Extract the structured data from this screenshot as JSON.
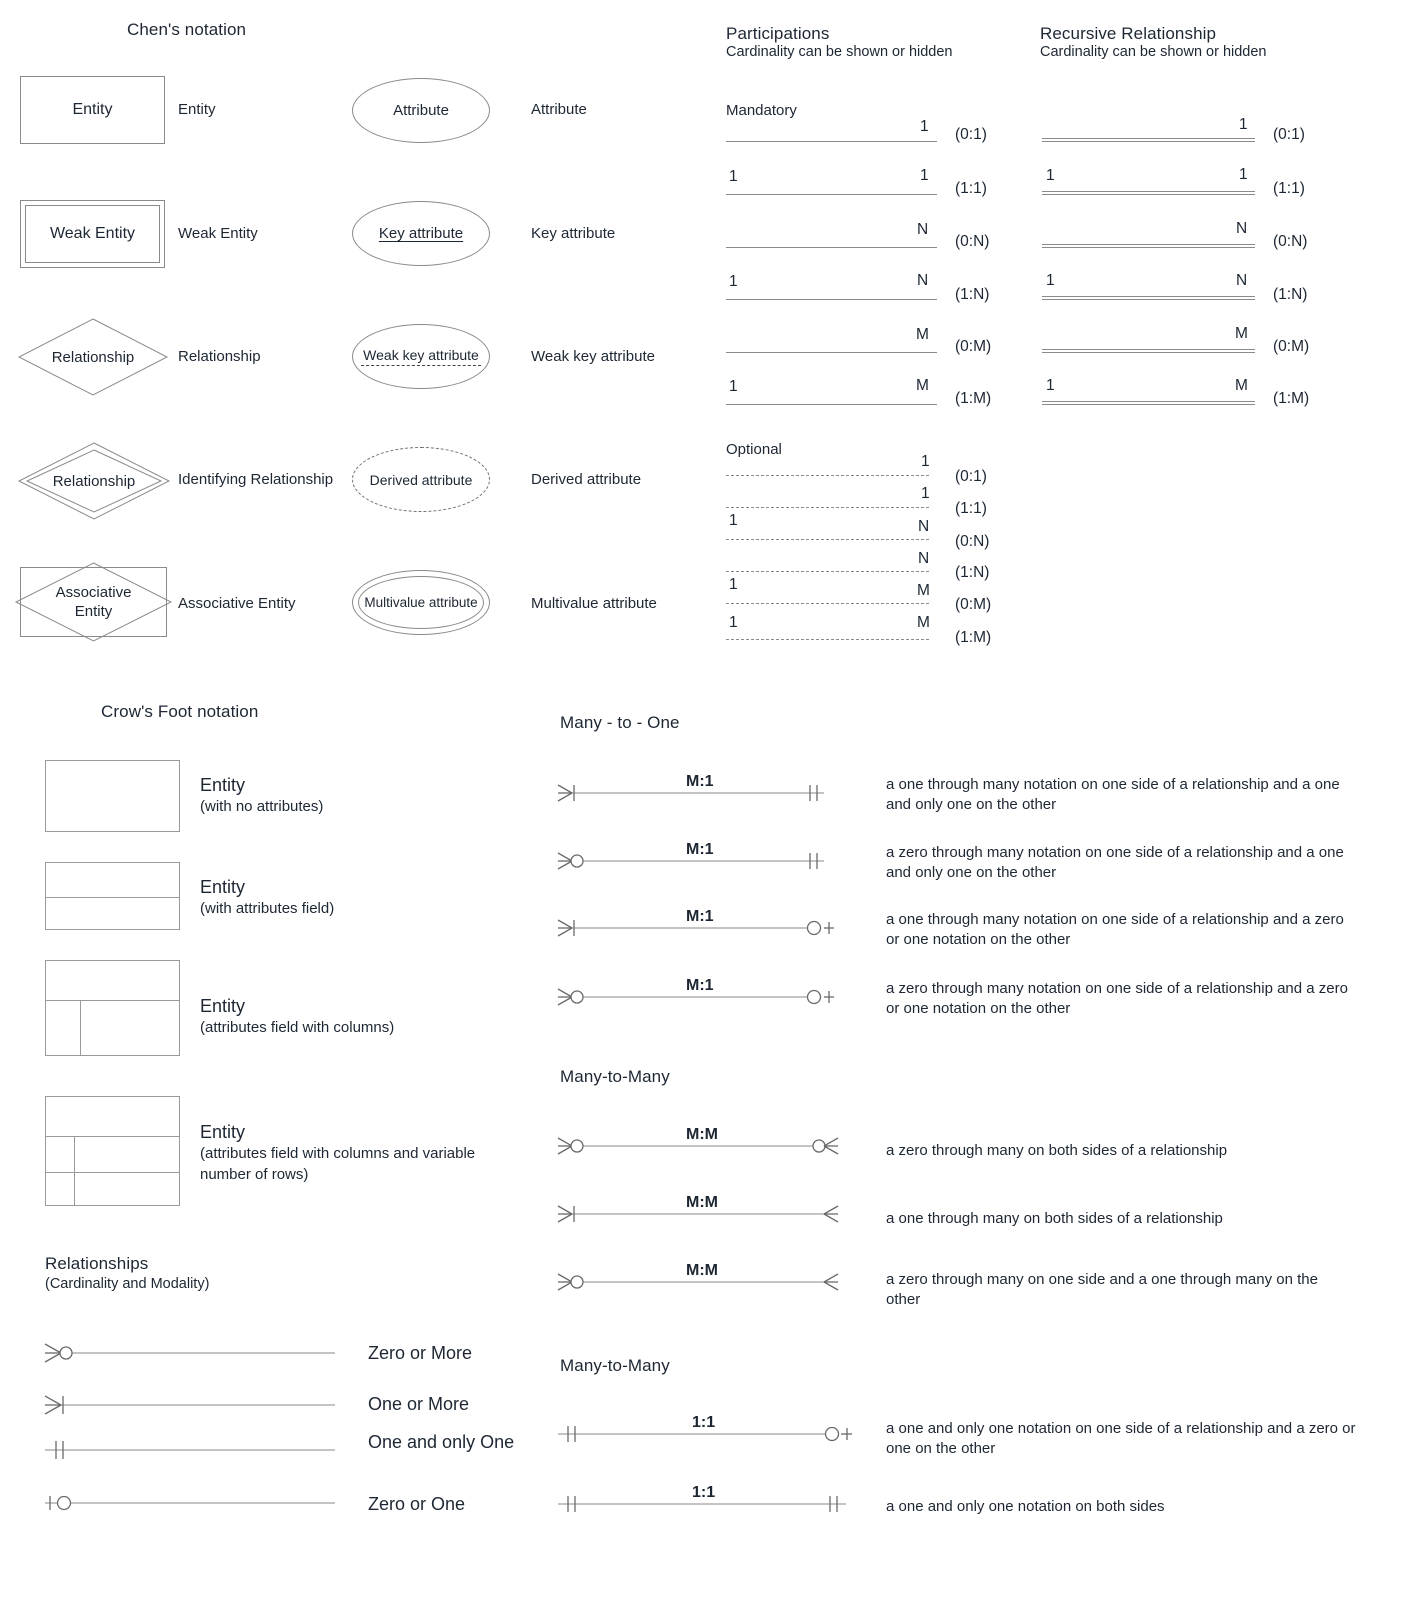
{
  "sections": {
    "chen": {
      "title": "Chen's notation"
    },
    "participations": {
      "title": "Participations",
      "subtitle": "Cardinality can be shown or hidden",
      "mandatory": "Mandatory",
      "optional": "Optional"
    },
    "recursive": {
      "title": "Recursive Relationship",
      "subtitle": "Cardinality can be shown or hidden"
    },
    "crowsfoot": {
      "title": "Crow's Foot notation"
    },
    "many_to_one": {
      "title": "Many - to - One"
    },
    "many_to_many": {
      "title": "Many-to-Many"
    },
    "one_to_one": {
      "title": "Many-to-Many"
    },
    "relationships": {
      "title": "Relationships",
      "subtitle": "(Cardinality and Modality)"
    }
  },
  "chen_symbols": [
    {
      "shape_text": "Entity",
      "label": "Entity"
    },
    {
      "shape_text": "Weak Entity",
      "label": "Weak Entity"
    },
    {
      "shape_text": "Relationship",
      "label": "Relationship"
    },
    {
      "shape_text": "Relationship",
      "label": "Identifying Relationship"
    },
    {
      "shape_text": "Associative Entity",
      "shape_line1": "Associative",
      "shape_line2": "Entity",
      "label": "Associative Entity"
    }
  ],
  "chen_attributes": [
    {
      "shape_text": "Attribute",
      "label": "Attribute"
    },
    {
      "shape_text": "Key attribute",
      "label": "Key attribute"
    },
    {
      "shape_text": "Weak key attribute",
      "label": "Weak key attribute"
    },
    {
      "shape_text": "Derived attribute",
      "label": "Derived attribute"
    },
    {
      "shape_text": "Multivalue attribute",
      "label": "Multivalue attribute"
    }
  ],
  "participations_mandatory": [
    {
      "left": "",
      "right": "1",
      "cardinality": "(0:1)"
    },
    {
      "left": "1",
      "right": "1",
      "cardinality": "(1:1)"
    },
    {
      "left": "",
      "right": "N",
      "cardinality": "(0:N)"
    },
    {
      "left": "1",
      "right": "N",
      "cardinality": "(1:N)"
    },
    {
      "left": "",
      "right": "M",
      "cardinality": "(0:M)"
    },
    {
      "left": "1",
      "right": "M",
      "cardinality": "(1:M)"
    }
  ],
  "participations_optional": [
    {
      "left": "",
      "right": "1",
      "cardinality": "(0:1)"
    },
    {
      "left": "",
      "right": "1",
      "cardinality": "(1:1)"
    },
    {
      "left": "1",
      "right": "N",
      "cardinality": "(0:N)"
    },
    {
      "left": "",
      "right": "N",
      "cardinality": "(1:N)"
    },
    {
      "left": "1",
      "right": "M",
      "cardinality": "(0:M)"
    },
    {
      "left": "1",
      "right": "M",
      "cardinality": "(1:M)"
    }
  ],
  "recursive_rows": [
    {
      "left": "",
      "right": "1",
      "cardinality": "(0:1)"
    },
    {
      "left": "1",
      "right": "1",
      "cardinality": "(1:1)"
    },
    {
      "left": "",
      "right": "N",
      "cardinality": "(0:N)"
    },
    {
      "left": "1",
      "right": "N",
      "cardinality": "(1:N)"
    },
    {
      "left": "",
      "right": "M",
      "cardinality": "(0:M)"
    },
    {
      "left": "1",
      "right": "M",
      "cardinality": "(1:M)"
    }
  ],
  "crowsfoot_entities": [
    {
      "name": "Entity",
      "desc": "(with no attributes)"
    },
    {
      "name": "Entity",
      "desc": "(with attributes field)"
    },
    {
      "name": "Entity",
      "desc": "(attributes field with columns)"
    },
    {
      "name": "Entity",
      "desc": "(attributes field with columns and variable number of rows)"
    }
  ],
  "relationship_legend": [
    {
      "symbol": "crowfoot-circle",
      "label": "Zero or More"
    },
    {
      "symbol": "crowfoot-bar",
      "label": "One or More"
    },
    {
      "symbol": "double-bar",
      "label": "One and only One"
    },
    {
      "symbol": "bar-circle",
      "label": "Zero or One"
    }
  ],
  "many_to_one_rows": [
    {
      "label": "M:1",
      "left": "crowfoot-bar",
      "right": "double-bar",
      "desc": "a one through many notation on one side of a relationship and a one and only one on the other"
    },
    {
      "label": "M:1",
      "left": "crowfoot-circle",
      "right": "double-bar",
      "desc": "a zero through many notation on one side of a relationship and a one and only one on the other"
    },
    {
      "label": "M:1",
      "left": "crowfoot-bar",
      "right": "circle-bar",
      "desc": "a one through many notation on one side of a relationship and a zero or one notation on the other"
    },
    {
      "label": "M:1",
      "left": "crowfoot-circle",
      "right": "circle-bar",
      "desc": "a zero through many notation on one side of a relationship and a zero or one notation on the other"
    }
  ],
  "many_to_many_rows": [
    {
      "label": "M:M",
      "left": "crowfoot-circle",
      "right": "circle-crowfoot",
      "desc": "a zero through many on both sides of a relationship"
    },
    {
      "label": "M:M",
      "left": "crowfoot-bar",
      "right": "bar-crowfoot",
      "desc": "a one through many on both sides of a relationship"
    },
    {
      "label": "M:M",
      "left": "crowfoot-circle",
      "right": "bar-crowfoot",
      "desc": "a zero through many on one side and a one through many on the other"
    }
  ],
  "one_to_one_rows": [
    {
      "label": "1:1",
      "left": "double-bar",
      "right": "circle-bar",
      "desc": "a one and only one notation on one side of a relationship and a zero or one on the other"
    },
    {
      "label": "1:1",
      "left": "double-bar",
      "right": "double-bar-r",
      "desc": "a one and only one notation on both sides"
    }
  ],
  "colors": {
    "stroke": "#8a8a8a",
    "text": "#1d2733",
    "box_stroke": "#9a9a9a"
  }
}
